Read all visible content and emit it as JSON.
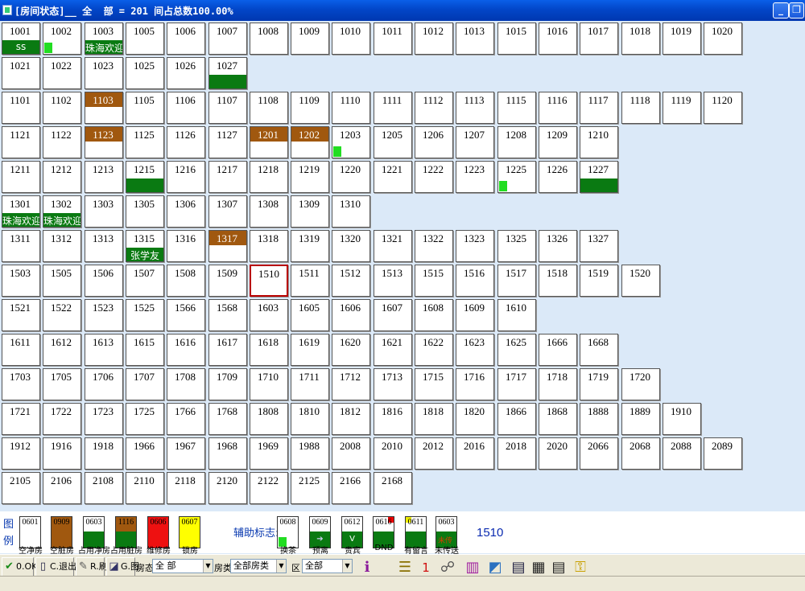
{
  "window": {
    "title": "[房间状态]__ 全  部 = 201 间占总数100.00%",
    "min": "_",
    "max": "❐"
  },
  "rows": [
    [
      {
        "n": "1001",
        "bar": "ss"
      },
      {
        "n": "1002",
        "dot": true
      },
      {
        "n": "1003",
        "bar": "珠海欢迎"
      },
      {
        "n": "1005"
      },
      {
        "n": "1006"
      },
      {
        "n": "1007"
      },
      {
        "n": "1008"
      },
      {
        "n": "1009"
      },
      {
        "n": "1010"
      },
      {
        "n": "1011"
      },
      {
        "n": "1012"
      },
      {
        "n": "1013"
      },
      {
        "n": "1015"
      },
      {
        "n": "1016"
      },
      {
        "n": "1017"
      },
      {
        "n": "1018"
      },
      {
        "n": "1019"
      },
      {
        "n": "1020"
      }
    ],
    [
      {
        "n": "1021"
      },
      {
        "n": "1022"
      },
      {
        "n": "1023"
      },
      {
        "n": "1025"
      },
      {
        "n": "1026"
      },
      {
        "n": "1027",
        "bar": ""
      }
    ],
    [
      {
        "n": "1101"
      },
      {
        "n": "1102"
      },
      {
        "n": "1103",
        "dirty": true
      },
      {
        "n": "1105"
      },
      {
        "n": "1106"
      },
      {
        "n": "1107"
      },
      {
        "n": "1108"
      },
      {
        "n": "1109"
      },
      {
        "n": "1110"
      },
      {
        "n": "1111"
      },
      {
        "n": "1112"
      },
      {
        "n": "1113"
      },
      {
        "n": "1115"
      },
      {
        "n": "1116"
      },
      {
        "n": "1117"
      },
      {
        "n": "1118"
      },
      {
        "n": "1119"
      },
      {
        "n": "1120"
      }
    ],
    [
      {
        "n": "1121"
      },
      {
        "n": "1122"
      },
      {
        "n": "1123",
        "dirty": true
      },
      {
        "n": "1125"
      },
      {
        "n": "1126"
      },
      {
        "n": "1127"
      },
      {
        "n": "1201",
        "dirty": true
      },
      {
        "n": "1202",
        "dirty": true
      },
      {
        "n": "1203",
        "dot": true
      },
      {
        "n": "1205"
      },
      {
        "n": "1206"
      },
      {
        "n": "1207"
      },
      {
        "n": "1208"
      },
      {
        "n": "1209"
      },
      {
        "n": "1210"
      }
    ],
    [
      {
        "n": "1211"
      },
      {
        "n": "1212"
      },
      {
        "n": "1213"
      },
      {
        "n": "1215",
        "bar": ""
      },
      {
        "n": "1216"
      },
      {
        "n": "1217"
      },
      {
        "n": "1218"
      },
      {
        "n": "1219"
      },
      {
        "n": "1220"
      },
      {
        "n": "1221"
      },
      {
        "n": "1222"
      },
      {
        "n": "1223"
      },
      {
        "n": "1225",
        "dot": true
      },
      {
        "n": "1226"
      },
      {
        "n": "1227",
        "bar": ""
      }
    ],
    [
      {
        "n": "1301",
        "bar": "珠海欢迎"
      },
      {
        "n": "1302",
        "bar": "珠海欢迎"
      },
      {
        "n": "1303"
      },
      {
        "n": "1305"
      },
      {
        "n": "1306"
      },
      {
        "n": "1307"
      },
      {
        "n": "1308"
      },
      {
        "n": "1309"
      },
      {
        "n": "1310"
      }
    ],
    [
      {
        "n": "1311"
      },
      {
        "n": "1312"
      },
      {
        "n": "1313"
      },
      {
        "n": "1315",
        "bar": "张学友"
      },
      {
        "n": "1316"
      },
      {
        "n": "1317",
        "dirty": true
      },
      {
        "n": "1318"
      },
      {
        "n": "1319"
      },
      {
        "n": "1320"
      },
      {
        "n": "1321"
      },
      {
        "n": "1322"
      },
      {
        "n": "1323"
      },
      {
        "n": "1325"
      },
      {
        "n": "1326"
      },
      {
        "n": "1327"
      }
    ],
    [
      {
        "n": "1503"
      },
      {
        "n": "1505"
      },
      {
        "n": "1506"
      },
      {
        "n": "1507"
      },
      {
        "n": "1508"
      },
      {
        "n": "1509"
      },
      {
        "n": "1510",
        "selected": true
      },
      {
        "n": "1511"
      },
      {
        "n": "1512"
      },
      {
        "n": "1513"
      },
      {
        "n": "1515"
      },
      {
        "n": "1516"
      },
      {
        "n": "1517"
      },
      {
        "n": "1518"
      },
      {
        "n": "1519"
      },
      {
        "n": "1520"
      }
    ],
    [
      {
        "n": "1521"
      },
      {
        "n": "1522"
      },
      {
        "n": "1523"
      },
      {
        "n": "1525"
      },
      {
        "n": "1566"
      },
      {
        "n": "1568"
      },
      {
        "n": "1603"
      },
      {
        "n": "1605"
      },
      {
        "n": "1606"
      },
      {
        "n": "1607"
      },
      {
        "n": "1608"
      },
      {
        "n": "1609"
      },
      {
        "n": "1610"
      }
    ],
    [
      {
        "n": "1611"
      },
      {
        "n": "1612"
      },
      {
        "n": "1613"
      },
      {
        "n": "1615"
      },
      {
        "n": "1616"
      },
      {
        "n": "1617"
      },
      {
        "n": "1618"
      },
      {
        "n": "1619"
      },
      {
        "n": "1620"
      },
      {
        "n": "1621"
      },
      {
        "n": "1622"
      },
      {
        "n": "1623"
      },
      {
        "n": "1625"
      },
      {
        "n": "1666"
      },
      {
        "n": "1668"
      }
    ],
    [
      {
        "n": "1703"
      },
      {
        "n": "1705"
      },
      {
        "n": "1706"
      },
      {
        "n": "1707"
      },
      {
        "n": "1708"
      },
      {
        "n": "1709"
      },
      {
        "n": "1710"
      },
      {
        "n": "1711"
      },
      {
        "n": "1712"
      },
      {
        "n": "1713"
      },
      {
        "n": "1715"
      },
      {
        "n": "1716"
      },
      {
        "n": "1717"
      },
      {
        "n": "1718"
      },
      {
        "n": "1719"
      },
      {
        "n": "1720"
      }
    ],
    [
      {
        "n": "1721"
      },
      {
        "n": "1722"
      },
      {
        "n": "1723"
      },
      {
        "n": "1725"
      },
      {
        "n": "1766"
      },
      {
        "n": "1768"
      },
      {
        "n": "1808"
      },
      {
        "n": "1810"
      },
      {
        "n": "1812"
      },
      {
        "n": "1816"
      },
      {
        "n": "1818"
      },
      {
        "n": "1820"
      },
      {
        "n": "1866"
      },
      {
        "n": "1868"
      },
      {
        "n": "1888"
      },
      {
        "n": "1889"
      },
      {
        "n": "1910"
      }
    ],
    [
      {
        "n": "1912"
      },
      {
        "n": "1916"
      },
      {
        "n": "1918"
      },
      {
        "n": "1966"
      },
      {
        "n": "1967"
      },
      {
        "n": "1968"
      },
      {
        "n": "1969"
      },
      {
        "n": "1988"
      },
      {
        "n": "2008"
      },
      {
        "n": "2010"
      },
      {
        "n": "2012"
      },
      {
        "n": "2016"
      },
      {
        "n": "2018"
      },
      {
        "n": "2020"
      },
      {
        "n": "2066"
      },
      {
        "n": "2068"
      },
      {
        "n": "2088"
      },
      {
        "n": "2089"
      }
    ],
    [
      {
        "n": "2105"
      },
      {
        "n": "2106"
      },
      {
        "n": "2108"
      },
      {
        "n": "2110"
      },
      {
        "n": "2118"
      },
      {
        "n": "2120"
      },
      {
        "n": "2122"
      },
      {
        "n": "2125"
      },
      {
        "n": "2166"
      },
      {
        "n": "2168"
      }
    ]
  ],
  "legend": {
    "label": "图例",
    "items": [
      {
        "num": "0601",
        "caption": "空净房",
        "color": "#ffffff"
      },
      {
        "num": "0909",
        "caption": "空脏房",
        "color": "#a0580f"
      },
      {
        "num": "0603",
        "caption": "占用净房",
        "color": "#ffffff",
        "green": true
      },
      {
        "num": "1116",
        "caption": "占用脏房",
        "color": "#a0580f",
        "green": true
      },
      {
        "num": "0606",
        "caption": "维修房",
        "color": "#ee1111"
      },
      {
        "num": "0607",
        "caption": "锁房",
        "color": "#ffff00"
      }
    ],
    "aux_label": "辅助标志:",
    "aux": [
      {
        "num": "0608",
        "caption": "换茶",
        "mark": "dot"
      },
      {
        "num": "0609",
        "caption": "预离",
        "mark": "arrow"
      },
      {
        "num": "0612",
        "caption": "贵宾",
        "mark": "V"
      },
      {
        "num": "0616",
        "caption": "DND",
        "mark": "red"
      },
      {
        "num": "0611",
        "caption": "有留言",
        "mark": "yellow"
      },
      {
        "num": "0603",
        "caption": "未传送",
        "mark": "txt",
        "txt": "未传"
      }
    ],
    "selected_room": "1510"
  },
  "toolbar": {
    "ok": "0.OK",
    "exit": "C.退出",
    "refresh": "R.刷",
    "graph": "G.图",
    "state_label": "房态",
    "state_value": "全  部",
    "type_label": "房类",
    "type_value": "全部房类",
    "zone_label": "区",
    "zone_value": "全部",
    "count": "1"
  }
}
